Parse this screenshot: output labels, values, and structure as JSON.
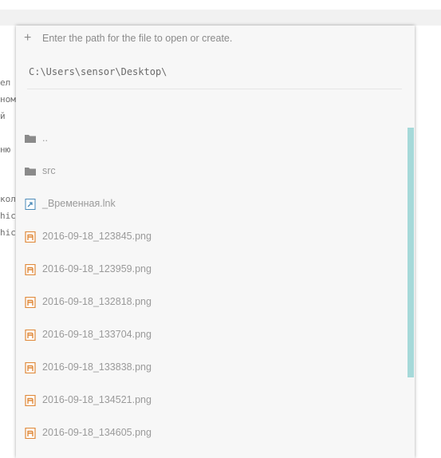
{
  "background_editor": {
    "lines": [
      "ел",
      "ном",
      "й",
      "",
      "ню",
      "",
      "",
      "кол",
      "hic",
      "hic"
    ]
  },
  "dialog": {
    "prompt": "Enter the path for the file to open or create.",
    "path_value": "C:\\Users\\sensor\\Desktop\\",
    "items": [
      {
        "label": "..",
        "icon": "folder-icon"
      },
      {
        "label": "src",
        "icon": "folder-icon"
      },
      {
        "label": "_Временная.lnk",
        "icon": "shortcut-file-icon"
      },
      {
        "label": "2016-09-18_123845.png",
        "icon": "image-file-icon"
      },
      {
        "label": "2016-09-18_123959.png",
        "icon": "image-file-icon"
      },
      {
        "label": "2016-09-18_132818.png",
        "icon": "image-file-icon"
      },
      {
        "label": "2016-09-18_133704.png",
        "icon": "image-file-icon"
      },
      {
        "label": "2016-09-18_133838.png",
        "icon": "image-file-icon"
      },
      {
        "label": "2016-09-18_134521.png",
        "icon": "image-file-icon"
      },
      {
        "label": "2016-09-18_134605.png",
        "icon": "image-file-icon"
      }
    ]
  },
  "colors": {
    "scroll_thumb": "#a6d9d9",
    "image_icon": "#e08a3c",
    "folder_icon": "#8a8a8a",
    "shortcut_icon": "#4a8ab8"
  }
}
